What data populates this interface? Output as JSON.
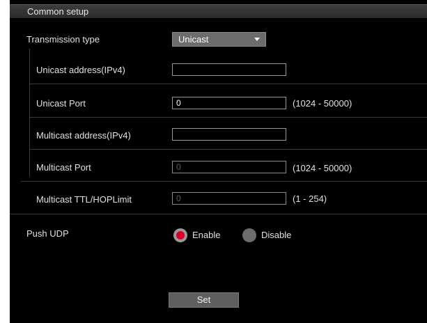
{
  "header": {
    "title": "Common setup"
  },
  "transmission": {
    "label": "Transmission type",
    "selected": "Unicast",
    "options": [
      "Unicast"
    ]
  },
  "unicast_address": {
    "label": "Unicast address(IPv4)",
    "value": ""
  },
  "unicast_port": {
    "label": "Unicast Port",
    "value": "0",
    "range": "(1024 - 50000)"
  },
  "multicast_address": {
    "label": "Multicast address(IPv4)",
    "value": ""
  },
  "multicast_port": {
    "label": "Multicast Port",
    "value": "0",
    "range": "(1024 - 50000)",
    "disabled": true
  },
  "multicast_ttl": {
    "label": "Multicast TTL/HOPLimit",
    "value": "0",
    "range": "(1 - 254)",
    "disabled": true
  },
  "push_udp": {
    "label": "Push UDP",
    "enable_label": "Enable",
    "disable_label": "Disable",
    "selected": "Enable"
  },
  "set_button": {
    "label": "Set"
  },
  "colors": {
    "background": "#000000",
    "header": "#333333",
    "radio_selected": "#d9002a",
    "button": "#5f5f5f"
  }
}
